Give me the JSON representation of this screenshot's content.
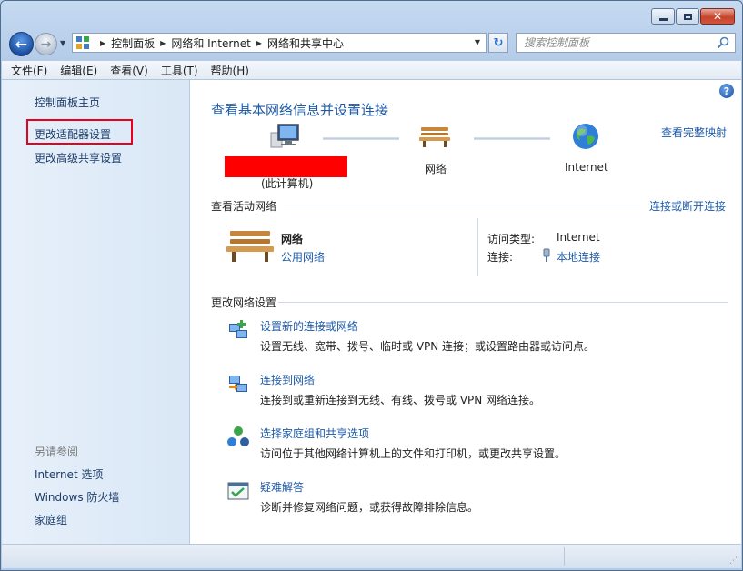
{
  "address_bar": {
    "crumbs": [
      "控制面板",
      "网络和 Internet",
      "网络和共享中心"
    ]
  },
  "search": {
    "placeholder": "搜索控制面板"
  },
  "menu": [
    "文件(F)",
    "编辑(E)",
    "查看(V)",
    "工具(T)",
    "帮助(H)"
  ],
  "sidebar": {
    "home": "控制面板主页",
    "items": [
      "更改适配器设置",
      "更改高级共享设置"
    ],
    "see_also_heading": "另请参阅",
    "see_also": [
      "Internet 选项",
      "Windows 防火墙",
      "家庭组"
    ]
  },
  "content": {
    "title": "查看基本网络信息并设置连接",
    "full_map_link": "查看完整映射",
    "map": {
      "computer_label": "(此计算机)",
      "network_label": "网络",
      "internet_label": "Internet"
    },
    "active_heading": "查看活动网络",
    "connect_link": "连接或断开连接",
    "active_network": {
      "name": "网络",
      "type": "公用网络",
      "access_label": "访问类型:",
      "access_value": "Internet",
      "conn_label": "连接:",
      "conn_value": "本地连接"
    },
    "change_heading": "更改网络设置",
    "tasks": [
      {
        "title": "设置新的连接或网络",
        "desc": "设置无线、宽带、拨号、临时或 VPN 连接；或设置路由器或访问点。"
      },
      {
        "title": "连接到网络",
        "desc": "连接到或重新连接到无线、有线、拨号或 VPN 网络连接。"
      },
      {
        "title": "选择家庭组和共享选项",
        "desc": "访问位于其他网络计算机上的文件和打印机，或更改共享设置。"
      },
      {
        "title": "疑难解答",
        "desc": "诊断并修复网络问题，或获得故障排除信息。"
      }
    ]
  },
  "colors": {
    "link": "#1e5aa8",
    "highlight_box": "#e8001c",
    "redaction": "#fe0000"
  }
}
